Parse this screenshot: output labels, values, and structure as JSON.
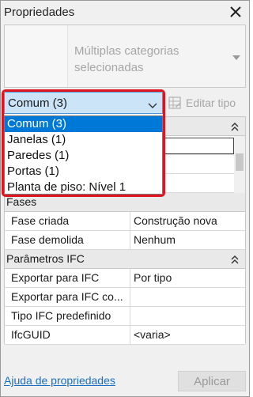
{
  "window": {
    "title": "Propriedades"
  },
  "type_selector": {
    "label": "Múltiplas categorias selecionadas"
  },
  "edit_type": {
    "label": "Editar tipo"
  },
  "filter": {
    "selected": "Comum (3)",
    "options": [
      "Comum (3)",
      "Janelas (1)",
      "Paredes (1)",
      "Portas (1)",
      "Planta de piso: Nível 1"
    ]
  },
  "properties": {
    "groups": [
      {
        "title": "Fases",
        "rows": [
          {
            "key": "Fase criada",
            "value": "Construção nova"
          },
          {
            "key": "Fase demolida",
            "value": "Nenhum"
          }
        ]
      },
      {
        "title": "Parâmetros IFC",
        "rows": [
          {
            "key": "Exportar para IFC",
            "value": "Por tipo"
          },
          {
            "key": "Exportar para IFC co...",
            "value": ""
          },
          {
            "key": "Tipo IFC predefinido",
            "value": ""
          },
          {
            "key": "IfcGUID",
            "value": "<varia>"
          }
        ]
      }
    ],
    "partial_value": ">"
  },
  "footer": {
    "help_link": "Ajuda de propriedades",
    "apply_label": "Aplicar"
  },
  "colors": {
    "selection": "#0078d7",
    "highlight_border": "#e0141e",
    "link": "#1a6fc4"
  }
}
